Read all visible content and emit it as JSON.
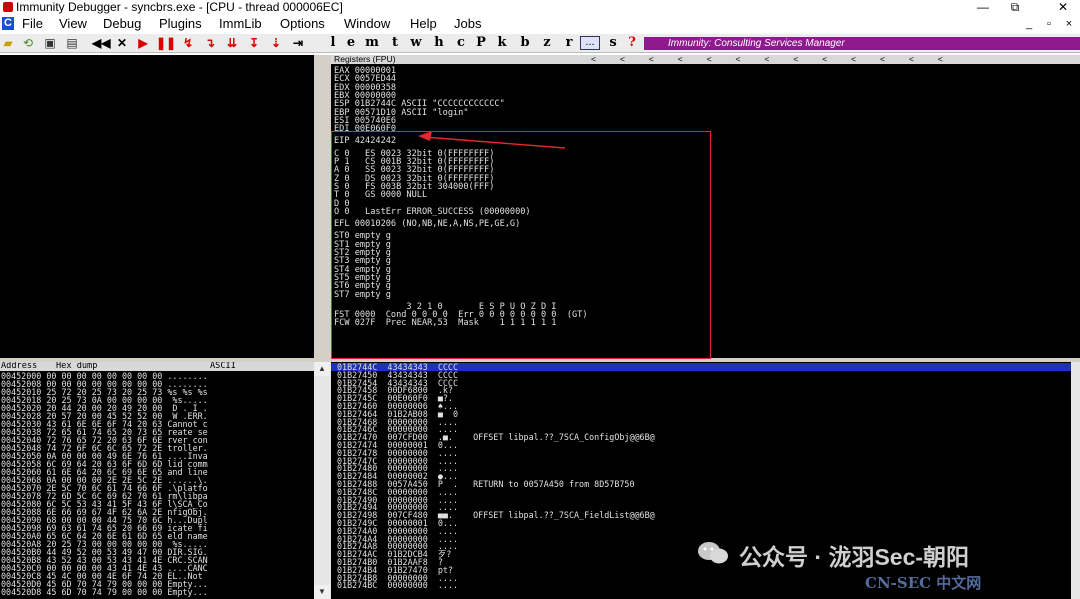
{
  "window": {
    "title": "Immunity Debugger - syncbrs.exe - [CPU - thread 000006EC]",
    "minimize": "—",
    "maximize": "⧉",
    "close": "✕"
  },
  "menu": {
    "cpu_icon": "C",
    "items": [
      "File",
      "View",
      "Debug",
      "Plugins",
      "ImmLib",
      "Options",
      "Window",
      "Help",
      "Jobs"
    ],
    "mdi_min": "_",
    "mdi_restore": "▫",
    "mdi_close": "×"
  },
  "toolbar": {
    "letters": [
      "l",
      "e",
      "m",
      "t",
      "w",
      "h",
      "c",
      "P",
      "k",
      "b",
      "z",
      "r",
      "...",
      "s",
      "?"
    ],
    "banner": "Immunity: Consulting Services Manager"
  },
  "registers": {
    "header": "Registers (FPU)",
    "header_arrows": "<          <          <          <          <          <          <          <          <          <          <          <          <",
    "lines": [
      "EAX 00000001",
      "ECX 0057ED44",
      "EDX 00000358",
      "EBX 00000000",
      "ESP 01B2744C ASCII \"CCCCCCCCCCCC\"",
      "EBP 00571D10 ASCII \"login\"",
      "ESI 005740E6",
      "EDI 00E060F0",
      "",
      "EIP 42424242",
      "",
      "C 0   ES 0023 32bit 0(FFFFFFFF)",
      "P 1   CS 001B 32bit 0(FFFFFFFF)",
      "A 0   SS 0023 32bit 0(FFFFFFFF)",
      "Z 0   DS 0023 32bit 0(FFFFFFFF)",
      "S 0   FS 003B 32bit 304000(FFF)",
      "T 0   GS 0000 NULL",
      "D 0",
      "O 0   LastErr ERROR_SUCCESS (00000000)",
      "",
      "EFL 00010206 (NO,NB,NE,A,NS,PE,GE,G)",
      "",
      "ST0 empty g",
      "ST1 empty g",
      "ST2 empty g",
      "ST3 empty g",
      "ST4 empty g",
      "ST5 empty g",
      "ST6 empty g",
      "ST7 empty g",
      "",
      "              3 2 1 0       E S P U O Z D I",
      "FST 0000  Cond 0 0 0 0  Err 0 0 0 0 0 0 0 0  (GT)",
      "FCW 027F  Prec NEAR,53  Mask    1 1 1 1 1 1"
    ]
  },
  "dump": {
    "col_address": "Address",
    "col_hex": "Hex dump",
    "col_ascii": "ASCII",
    "rows": [
      "00452000 00 00 00 00 00 00 00 00 ........",
      "00452008 00 00 00 00 00 00 00 00 ........",
      "00452010 25 72 20 25 73 20 25 73 %s %s %s",
      "00452018 20 25 73 0A 00 00 00 00  %s.....",
      "00452020 20 44 20 00 20 49 20 00  D . I .",
      "00452028 20 57 20 00 45 52 52 00  W .ERR.",
      "00452030 43 61 6E 6E 6F 74 20 63 Cannot c",
      "00452038 72 65 61 74 65 20 73 65 reate se",
      "00452040 72 76 65 72 20 63 6F 6E rver con",
      "00452048 74 72 6F 6C 6C 65 72 2E troller.",
      "00452050 0A 00 00 00 49 6E 76 61 ....Inva",
      "00452058 6C 69 64 20 63 6F 6D 6D lid comm",
      "00452060 61 6E 64 20 6C 69 6E 65 and line",
      "00452068 0A 00 00 00 2E 2E 5C 2E ......\\.",
      "00452070 2E 5C 70 6C 61 74 66 6F .\\platfo",
      "00452078 72 6D 5C 6C 69 62 70 61 rm\\libpa",
      "00452080 6C 5C 53 43 41 5F 43 6F l\\SCA_Co",
      "00452088 6E 66 69 67 4F 62 6A 2E nfigObj.",
      "00452090 68 00 00 00 44 75 70 6C h...Dupl",
      "00452098 69 63 61 74 65 20 66 69 icate fi",
      "004520A0 65 6C 64 20 6E 61 6D 65 eld name",
      "004520A8 20 25 73 00 00 00 00 00  %s.....",
      "004520B0 44 49 52 00 53 49 47 00 DIR.SIG.",
      "004520B8 43 52 43 00 53 43 41 4E CRC.SCAN",
      "004520C0 00 00 00 00 43 41 4E 43 ....CANC",
      "004520C8 45 4C 00 00 4E 6F 74 20 EL..Not ",
      "004520D0 45 6D 70 74 79 00 00 00 Empty...",
      "004520D8 45 6D 70 74 79 00 00 00 Empty..."
    ]
  },
  "stack": {
    "rows": [
      "01B2744C  43434343  CCCC",
      "01B27450  43434343  CCCC",
      "01B27454  43434343  CCCC",
      "01B27458  00DF6800  .k?",
      "01B2745C  00E060F0  ■?.",
      "01B27460  00000006  ♠...",
      "01B27464  01B2AB08  ■  0",
      "01B27468  00000000  ....",
      "01B2746C  00000000  ....",
      "01B27470  007CFD00  .■.    OFFSET libpal.??_7SCA_ConfigObj@@6B@",
      "01B27474  00000001  0...",
      "01B27478  00000000  ....",
      "01B2747C  00000000  ....",
      "01B27480  00000000  ....",
      "01B27484  00000002  ●...",
      "01B27488  0057A450  P  .   RETURN to 0057A450 from 8D57B750",
      "01B2748C  00000000  ....",
      "01B27490  00000000  ....",
      "01B27494  00000000  ....",
      "01B27498  007CF480  ■■.    OFFSET libpal.??_7SCA_FieldList@@6B@",
      "01B2749C  00000001  0...",
      "01B274A0  00000000  ....",
      "01B274A4  00000000  ....",
      "01B274A8  00000000  ....",
      "01B274AC  01B2DCB4  歹?",
      "01B274B0  01B2AAF8  ?",
      "01B274B4  01B27470  pt?",
      "01B274B8  00000000  ....",
      "01B274BC  00000000  ...."
    ]
  },
  "watermark": {
    "text": "公众号 · 泷羽Sec-朝阳",
    "site": "CN-SEC 中文网"
  },
  "colors": {
    "banner": "#8e1a8e",
    "highlight_box": "#e0282e",
    "selection": "#1f2fbf"
  }
}
